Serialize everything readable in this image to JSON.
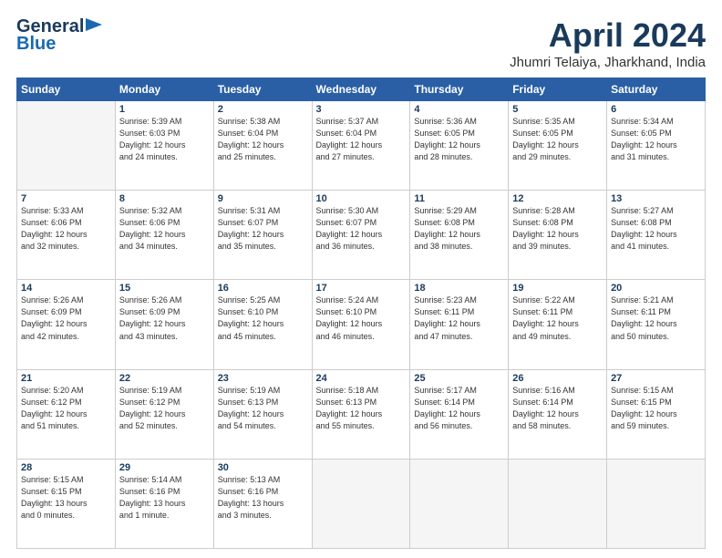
{
  "header": {
    "logo_line1": "General",
    "logo_line2": "Blue",
    "month_title": "April 2024",
    "location": "Jhumri Telaiya, Jharkhand, India"
  },
  "weekdays": [
    "Sunday",
    "Monday",
    "Tuesday",
    "Wednesday",
    "Thursday",
    "Friday",
    "Saturday"
  ],
  "weeks": [
    [
      {
        "num": "",
        "detail": ""
      },
      {
        "num": "1",
        "detail": "Sunrise: 5:39 AM\nSunset: 6:03 PM\nDaylight: 12 hours\nand 24 minutes."
      },
      {
        "num": "2",
        "detail": "Sunrise: 5:38 AM\nSunset: 6:04 PM\nDaylight: 12 hours\nand 25 minutes."
      },
      {
        "num": "3",
        "detail": "Sunrise: 5:37 AM\nSunset: 6:04 PM\nDaylight: 12 hours\nand 27 minutes."
      },
      {
        "num": "4",
        "detail": "Sunrise: 5:36 AM\nSunset: 6:05 PM\nDaylight: 12 hours\nand 28 minutes."
      },
      {
        "num": "5",
        "detail": "Sunrise: 5:35 AM\nSunset: 6:05 PM\nDaylight: 12 hours\nand 29 minutes."
      },
      {
        "num": "6",
        "detail": "Sunrise: 5:34 AM\nSunset: 6:05 PM\nDaylight: 12 hours\nand 31 minutes."
      }
    ],
    [
      {
        "num": "7",
        "detail": "Sunrise: 5:33 AM\nSunset: 6:06 PM\nDaylight: 12 hours\nand 32 minutes."
      },
      {
        "num": "8",
        "detail": "Sunrise: 5:32 AM\nSunset: 6:06 PM\nDaylight: 12 hours\nand 34 minutes."
      },
      {
        "num": "9",
        "detail": "Sunrise: 5:31 AM\nSunset: 6:07 PM\nDaylight: 12 hours\nand 35 minutes."
      },
      {
        "num": "10",
        "detail": "Sunrise: 5:30 AM\nSunset: 6:07 PM\nDaylight: 12 hours\nand 36 minutes."
      },
      {
        "num": "11",
        "detail": "Sunrise: 5:29 AM\nSunset: 6:08 PM\nDaylight: 12 hours\nand 38 minutes."
      },
      {
        "num": "12",
        "detail": "Sunrise: 5:28 AM\nSunset: 6:08 PM\nDaylight: 12 hours\nand 39 minutes."
      },
      {
        "num": "13",
        "detail": "Sunrise: 5:27 AM\nSunset: 6:08 PM\nDaylight: 12 hours\nand 41 minutes."
      }
    ],
    [
      {
        "num": "14",
        "detail": "Sunrise: 5:26 AM\nSunset: 6:09 PM\nDaylight: 12 hours\nand 42 minutes."
      },
      {
        "num": "15",
        "detail": "Sunrise: 5:26 AM\nSunset: 6:09 PM\nDaylight: 12 hours\nand 43 minutes."
      },
      {
        "num": "16",
        "detail": "Sunrise: 5:25 AM\nSunset: 6:10 PM\nDaylight: 12 hours\nand 45 minutes."
      },
      {
        "num": "17",
        "detail": "Sunrise: 5:24 AM\nSunset: 6:10 PM\nDaylight: 12 hours\nand 46 minutes."
      },
      {
        "num": "18",
        "detail": "Sunrise: 5:23 AM\nSunset: 6:11 PM\nDaylight: 12 hours\nand 47 minutes."
      },
      {
        "num": "19",
        "detail": "Sunrise: 5:22 AM\nSunset: 6:11 PM\nDaylight: 12 hours\nand 49 minutes."
      },
      {
        "num": "20",
        "detail": "Sunrise: 5:21 AM\nSunset: 6:11 PM\nDaylight: 12 hours\nand 50 minutes."
      }
    ],
    [
      {
        "num": "21",
        "detail": "Sunrise: 5:20 AM\nSunset: 6:12 PM\nDaylight: 12 hours\nand 51 minutes."
      },
      {
        "num": "22",
        "detail": "Sunrise: 5:19 AM\nSunset: 6:12 PM\nDaylight: 12 hours\nand 52 minutes."
      },
      {
        "num": "23",
        "detail": "Sunrise: 5:19 AM\nSunset: 6:13 PM\nDaylight: 12 hours\nand 54 minutes."
      },
      {
        "num": "24",
        "detail": "Sunrise: 5:18 AM\nSunset: 6:13 PM\nDaylight: 12 hours\nand 55 minutes."
      },
      {
        "num": "25",
        "detail": "Sunrise: 5:17 AM\nSunset: 6:14 PM\nDaylight: 12 hours\nand 56 minutes."
      },
      {
        "num": "26",
        "detail": "Sunrise: 5:16 AM\nSunset: 6:14 PM\nDaylight: 12 hours\nand 58 minutes."
      },
      {
        "num": "27",
        "detail": "Sunrise: 5:15 AM\nSunset: 6:15 PM\nDaylight: 12 hours\nand 59 minutes."
      }
    ],
    [
      {
        "num": "28",
        "detail": "Sunrise: 5:15 AM\nSunset: 6:15 PM\nDaylight: 13 hours\nand 0 minutes."
      },
      {
        "num": "29",
        "detail": "Sunrise: 5:14 AM\nSunset: 6:16 PM\nDaylight: 13 hours\nand 1 minute."
      },
      {
        "num": "30",
        "detail": "Sunrise: 5:13 AM\nSunset: 6:16 PM\nDaylight: 13 hours\nand 3 minutes."
      },
      {
        "num": "",
        "detail": ""
      },
      {
        "num": "",
        "detail": ""
      },
      {
        "num": "",
        "detail": ""
      },
      {
        "num": "",
        "detail": ""
      }
    ]
  ]
}
